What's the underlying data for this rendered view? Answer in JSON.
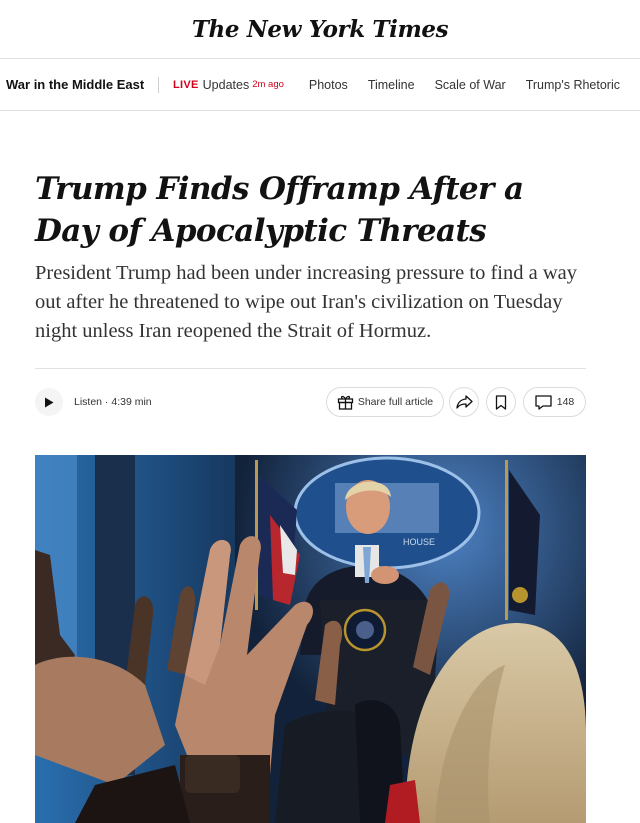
{
  "masthead": {
    "logo_text": "The New York Times"
  },
  "subnav": {
    "section_title": "War in the Middle East",
    "live_label": "LIVE",
    "updates_label": "Updates",
    "updated_ago": "2m ago",
    "links": [
      "Photos",
      "Timeline",
      "Scale of War",
      "Trump's Rhetoric"
    ]
  },
  "article": {
    "headline": "Trump Finds Offramp After a Day of Apocalyptic Threats",
    "summary": "President Trump had been under increasing pressure to find a way out after he threatened to wipe out Iran's civilization on Tuesday night unless Iran reopened the Strait of Hormuz."
  },
  "toolbar": {
    "listen_label": "Listen · 4:39 min",
    "share_full_label": "Share full article",
    "comments_count": "148"
  },
  "photo": {
    "sign_text": "HOUSE"
  },
  "colors": {
    "live_red": "#d0021b",
    "text": "#121212",
    "rule": "#e2e2e2"
  }
}
